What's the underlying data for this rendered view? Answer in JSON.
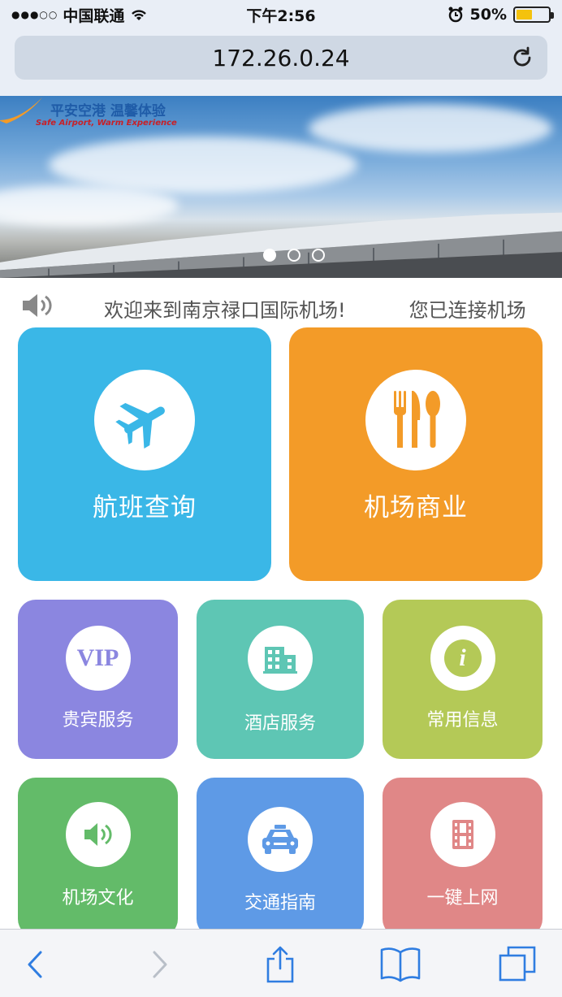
{
  "status_bar": {
    "carrier": "中国联通",
    "time": "下午2:56",
    "battery_percent_label": "50%",
    "battery_level": 0.5,
    "signal_icon": "signal-dots-icon",
    "wifi_icon": "wifi-icon",
    "alarm_icon": "alarm-clock-icon"
  },
  "address_bar": {
    "url": "172.26.0.24",
    "reload_icon": "reload-icon"
  },
  "banner": {
    "logo_text": "平安空港 温馨体验",
    "logo_subtext": "Safe Airport, Warm Experience",
    "slide_count": 3,
    "active_slide": 1
  },
  "marquee": {
    "icon": "speaker-icon",
    "messages": [
      "欢迎来到南京禄口国际机场!",
      "您已连接机场"
    ]
  },
  "tiles": [
    {
      "label": "航班查询",
      "icon": "airplane-icon",
      "color": "#3ab7e7"
    },
    {
      "label": "机场商业",
      "icon": "fork-knife-spoon-icon",
      "color": "#f39b28"
    },
    {
      "label": "贵宾服务",
      "icon": "vip-icon",
      "icon_text": "VIP",
      "color": "#8b86e0"
    },
    {
      "label": "酒店服务",
      "icon": "hotel-building-icon",
      "color": "#5ec6b4"
    },
    {
      "label": "常用信息",
      "icon": "info-icon",
      "icon_text": "i",
      "color": "#b4c957"
    },
    {
      "label": "机场文化",
      "icon": "speaker-icon",
      "color": "#63bb69"
    },
    {
      "label": "交通指南",
      "icon": "taxi-icon",
      "color": "#5e9ae6"
    },
    {
      "label": "一键上网",
      "icon": "film-icon",
      "color": "#e08787"
    }
  ],
  "toolbar": {
    "back_icon": "back-arrow-icon",
    "forward_icon": "forward-arrow-icon",
    "share_icon": "share-icon",
    "bookmarks_icon": "book-icon",
    "tabs_icon": "tabs-icon"
  }
}
